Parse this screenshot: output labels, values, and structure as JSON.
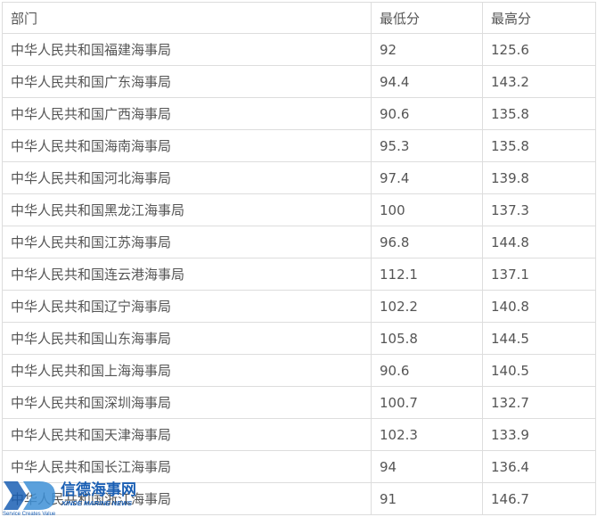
{
  "table": {
    "headers": [
      "部门",
      "最低分",
      "最高分"
    ],
    "rows": [
      [
        "中华人民共和国福建海事局",
        "92",
        "125.6"
      ],
      [
        "中华人民共和国广东海事局",
        "94.4",
        "143.2"
      ],
      [
        "中华人民共和国广西海事局",
        "90.6",
        "135.8"
      ],
      [
        "中华人民共和国海南海事局",
        "95.3",
        "135.8"
      ],
      [
        "中华人民共和国河北海事局",
        "97.4",
        "139.8"
      ],
      [
        "中华人民共和国黑龙江海事局",
        "100",
        "137.3"
      ],
      [
        "中华人民共和国江苏海事局",
        "96.8",
        "144.8"
      ],
      [
        "中华人民共和国连云港海事局",
        "112.1",
        "137.1"
      ],
      [
        "中华人民共和国辽宁海事局",
        "102.2",
        "140.8"
      ],
      [
        "中华人民共和国山东海事局",
        "105.8",
        "144.5"
      ],
      [
        "中华人民共和国上海海事局",
        "90.6",
        "140.5"
      ],
      [
        "中华人民共和国深圳海事局",
        "100.7",
        "132.7"
      ],
      [
        "中华人民共和国天津海事局",
        "102.3",
        "133.9"
      ],
      [
        "中华人民共和国长江海事局",
        "94",
        "136.4"
      ],
      [
        "中华人民共和国浙江海事局",
        "91",
        "146.7"
      ]
    ]
  },
  "watermark": {
    "logo_letters": "XD",
    "title": "信德海事网",
    "subtitle": "XINDE MARINE NEWS",
    "slogan": "Service Creates Value",
    "color": "#1a5fb4"
  }
}
